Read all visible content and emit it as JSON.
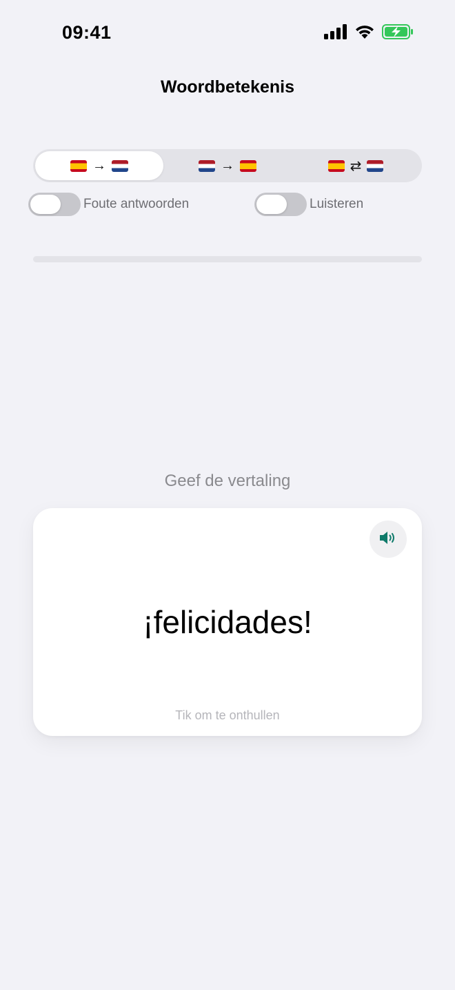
{
  "status_bar": {
    "time": "09:41",
    "icons": [
      "cellular-signal-icon",
      "wifi-icon",
      "battery-charging-icon"
    ],
    "battery_color": "#34c759"
  },
  "header": {
    "title": "Woordbetekenis"
  },
  "direction_selector": {
    "options": [
      {
        "from_flag": "es-flag",
        "arrow": "→",
        "to_flag": "nl-flag",
        "selected": true
      },
      {
        "from_flag": "nl-flag",
        "arrow": "→",
        "to_flag": "es-flag",
        "selected": false
      },
      {
        "from_flag": "es-flag",
        "arrow": "⇄",
        "to_flag": "nl-flag",
        "selected": false
      }
    ]
  },
  "toggles": {
    "wrong_answers": {
      "label": "Foute antwoorden",
      "on": false
    },
    "listening": {
      "label": "Luisteren",
      "on": false
    }
  },
  "progress": {
    "value": 0
  },
  "quiz": {
    "prompt": "Geef de vertaling",
    "word": "¡felicidades!",
    "hint": "Tik om te onthullen",
    "speaker_icon": "speaker-icon",
    "accent_color": "#0f7a6a"
  }
}
